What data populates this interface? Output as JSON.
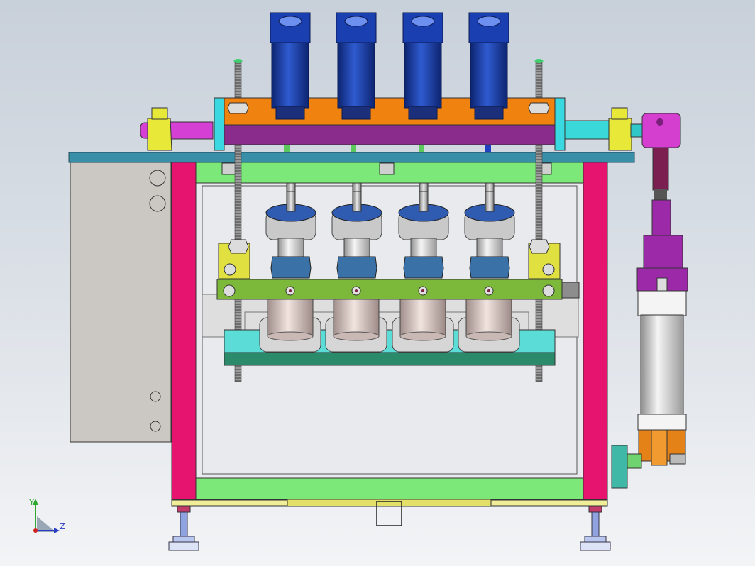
{
  "viewport": {
    "background": "#dde2e8"
  },
  "triad": {
    "y_label": "Y",
    "z_label": "Z"
  },
  "colors": {
    "frame_post": "#e6136f",
    "top_plate": "#3a8fa8",
    "green_rail": "#7de87a",
    "orange_bar": "#f0820f",
    "purple_bar": "#8a2c8c",
    "motor_blue": "#1f3f9c",
    "olive_bar": "#7db83a",
    "cyan_base": "#55dfd8",
    "yellow_block": "#e6e83c",
    "magenta_arm": "#d43fd0",
    "cylinder_body": "#eeeeee",
    "panel_gray": "#cbc8c3"
  },
  "parts": {
    "motors": 4,
    "spindles": 4,
    "leveling_feet": 2
  }
}
